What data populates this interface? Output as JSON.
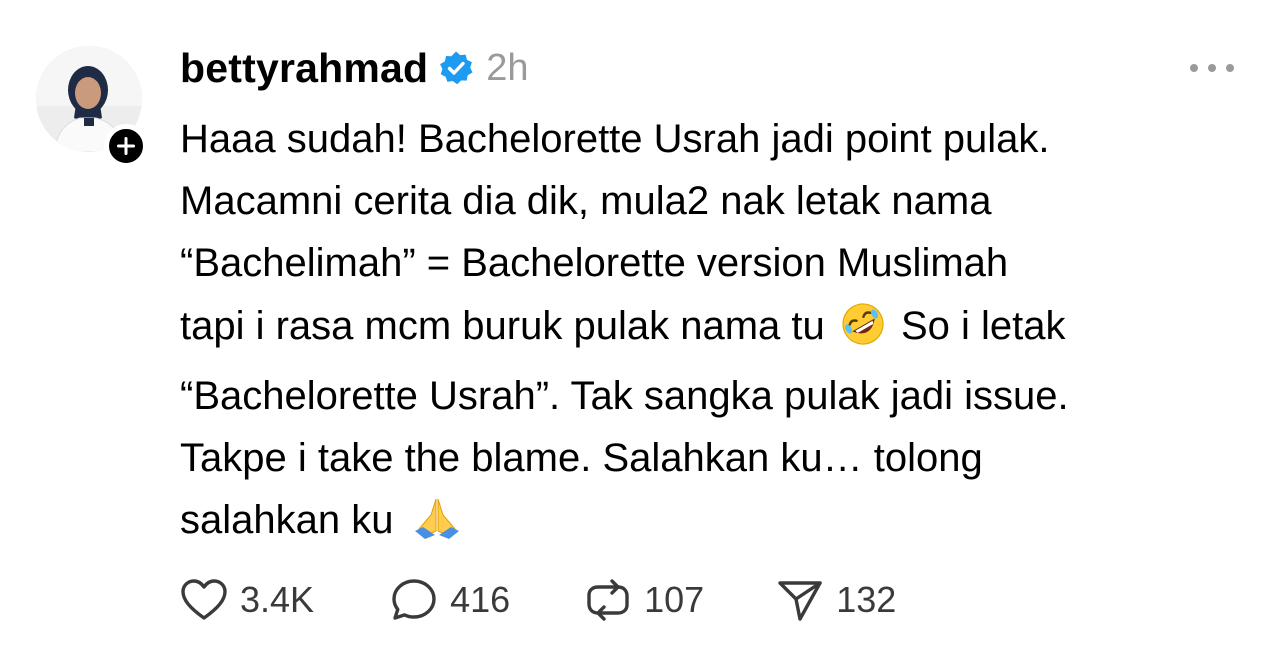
{
  "post": {
    "author": {
      "username": "bettyrahmad",
      "verified": true,
      "avatar": "profile-photo"
    },
    "timestamp": "2h",
    "text_lines": [
      "Haaa sudah! Bachelorette Usrah jadi point pulak.",
      "Macamni cerita dia dik, mula2 nak letak nama",
      "“Bachelimah” = Bachelorette version Muslimah",
      "tapi i rasa mcm buruk pulak nama tu",
      "So i letak",
      "“Bachelorette Usrah”. Tak sangka pulak jadi issue.",
      "Takpe i take the blame. Salahkan ku… tolong",
      "salahkan ku"
    ],
    "emojis": [
      "rolling-on-floor-laughing",
      "folded-hands"
    ],
    "actions": {
      "likes": "3.4K",
      "replies": "416",
      "reposts": "107",
      "shares": "132"
    }
  },
  "colors": {
    "verified_blue": "#1d9bf0",
    "muted_gray": "#9a9a9a",
    "count_gray": "#3a3a3a"
  }
}
